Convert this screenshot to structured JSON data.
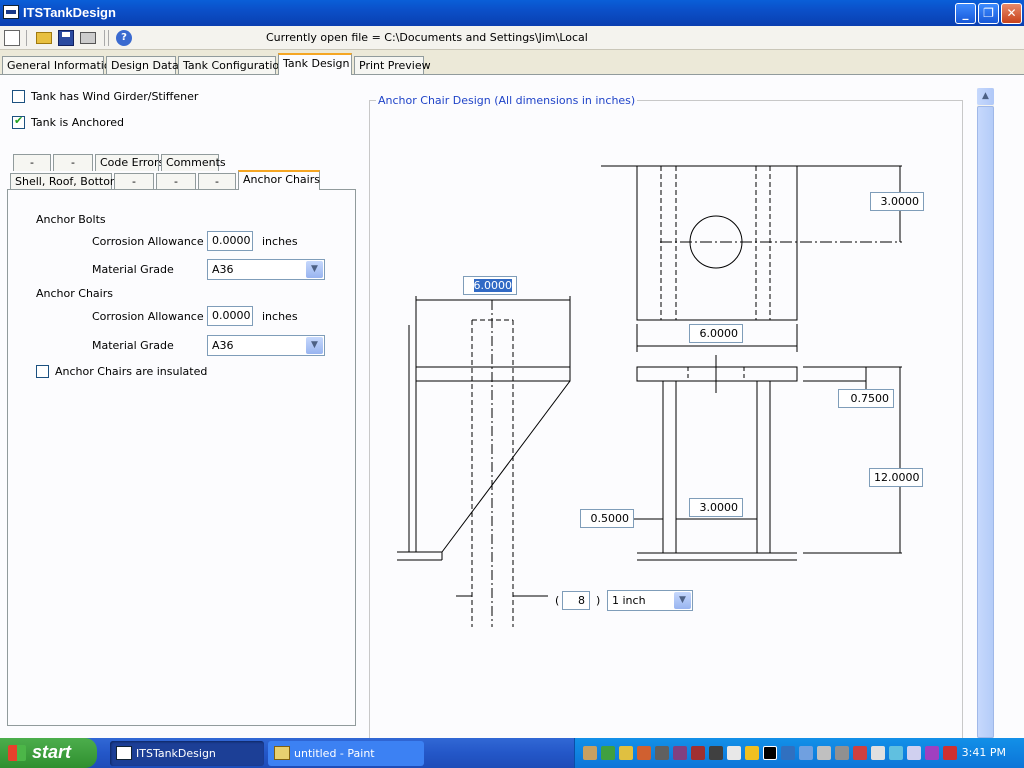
{
  "window": {
    "title": "ITSTankDesign"
  },
  "toolbar": {
    "open_file": "Currently open file = C:\\Documents and Settings\\Jim\\Local"
  },
  "main_tabs": [
    "General Information",
    "Design Data",
    "Tank Configuration",
    "Tank Design",
    "Print Preview"
  ],
  "options": {
    "wind_girder": {
      "label": "Tank has Wind Girder/Stiffener",
      "checked": false
    },
    "anchored": {
      "label": "Tank is Anchored",
      "checked": true
    }
  },
  "sub_tabs_back": [
    "-",
    "-",
    "Code Errors",
    "Comments"
  ],
  "sub_tabs_front": [
    "Shell, Roof, Bottom",
    "-",
    "-",
    "-",
    "Anchor Chairs"
  ],
  "anchor_bolts": {
    "heading": "Anchor Bolts",
    "ca_label": "Corrosion Allowance",
    "ca_value": "0.0000",
    "ca_unit": "inches",
    "grade_label": "Material Grade",
    "grade_value": "A36"
  },
  "anchor_chairs": {
    "heading": "Anchor Chairs",
    "ca_label": "Corrosion Allowance",
    "ca_value": "0.0000",
    "ca_unit": "inches",
    "grade_label": "Material Grade",
    "grade_value": "A36",
    "insulated_label": "Anchor Chairs are insulated",
    "insulated_checked": false
  },
  "drawing": {
    "title": "Anchor Chair Design (All dimensions in inches)",
    "dim_top_height": "3.0000",
    "dim_side_width": "6.0000",
    "dim_plan_width": "6.0000",
    "dim_cap_thickness": "0.7500",
    "dim_chair_height": "12.0000",
    "dim_gusset_thickness": "0.5000",
    "dim_gusset_spacing": "3.0000",
    "bolt_count_open": "(",
    "bolt_count": "8",
    "bolt_count_close": ")",
    "bolt_size": "1   inch"
  },
  "taskbar": {
    "start": "start",
    "tasks": [
      "ITSTankDesign",
      "untitled - Paint"
    ],
    "clock": "3:41 PM"
  }
}
